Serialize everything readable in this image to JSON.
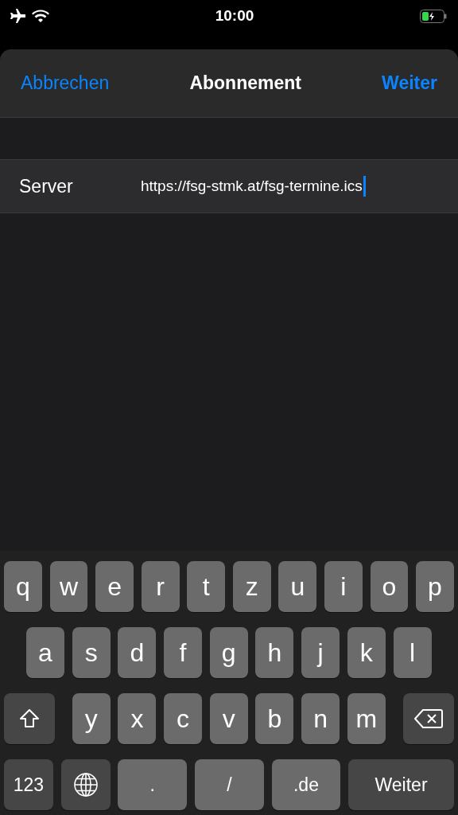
{
  "status_bar": {
    "time": "10:00",
    "airplane_mode": true,
    "battery_charging": true
  },
  "sheet": {
    "cancel": "Abbrechen",
    "title": "Abonnement",
    "next": "Weiter"
  },
  "fields": [
    {
      "label": "Server",
      "value": "https://fsg-stmk.at/fsg-termine.ics",
      "focused": true
    }
  ],
  "keyboard": {
    "rows": [
      {
        "keys": [
          {
            "kind": "letter",
            "label": "q"
          },
          {
            "kind": "letter",
            "label": "w"
          },
          {
            "kind": "letter",
            "label": "e"
          },
          {
            "kind": "letter",
            "label": "r"
          },
          {
            "kind": "letter",
            "label": "t"
          },
          {
            "kind": "letter",
            "label": "z"
          },
          {
            "kind": "letter",
            "label": "u"
          },
          {
            "kind": "letter",
            "label": "i"
          },
          {
            "kind": "letter",
            "label": "o"
          },
          {
            "kind": "letter",
            "label": "p"
          }
        ]
      },
      {
        "keys": [
          {
            "kind": "letter",
            "label": "a"
          },
          {
            "kind": "letter",
            "label": "s"
          },
          {
            "kind": "letter",
            "label": "d"
          },
          {
            "kind": "letter",
            "label": "f"
          },
          {
            "kind": "letter",
            "label": "g"
          },
          {
            "kind": "letter",
            "label": "h"
          },
          {
            "kind": "letter",
            "label": "j"
          },
          {
            "kind": "letter",
            "label": "k"
          },
          {
            "kind": "letter",
            "label": "l"
          }
        ]
      },
      {
        "keys": [
          {
            "kind": "shift"
          },
          {
            "kind": "letter",
            "label": "y"
          },
          {
            "kind": "letter",
            "label": "x"
          },
          {
            "kind": "letter",
            "label": "c"
          },
          {
            "kind": "letter",
            "label": "v"
          },
          {
            "kind": "letter",
            "label": "b"
          },
          {
            "kind": "letter",
            "label": "n"
          },
          {
            "kind": "letter",
            "label": "m"
          },
          {
            "kind": "backspace"
          }
        ]
      },
      {
        "keys": [
          {
            "kind": "mode",
            "label": "123"
          },
          {
            "kind": "globe"
          },
          {
            "kind": "wide",
            "label": "."
          },
          {
            "kind": "wide",
            "label": "/"
          },
          {
            "kind": "wide",
            "label": ".de"
          },
          {
            "kind": "action",
            "label": "Weiter"
          }
        ]
      }
    ]
  }
}
